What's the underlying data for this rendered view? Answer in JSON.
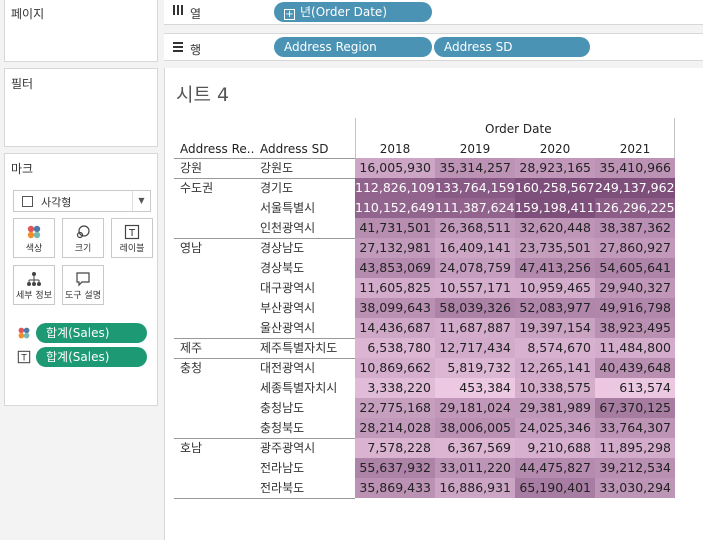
{
  "panels": {
    "pages_title": "페이지",
    "filters_title": "필터",
    "marks_title": "마크"
  },
  "marks": {
    "type_label": "사각형",
    "buttons": [
      {
        "label": "색상",
        "icon": "color-dots-icon"
      },
      {
        "label": "크기",
        "icon": "size-icon"
      },
      {
        "label": "레이블",
        "icon": "label-t-icon"
      },
      {
        "label": "세부 정보",
        "icon": "detail-tree-icon"
      },
      {
        "label": "도구 설명",
        "icon": "tooltip-bubble-icon"
      }
    ],
    "fields": [
      {
        "label": "합계(Sales)",
        "icon": "color-dots-icon"
      },
      {
        "label": "합계(Sales)",
        "icon": "label-t-icon"
      }
    ]
  },
  "shelves": {
    "columns_label": "열",
    "rows_label": "행",
    "columns_pills": [
      "년(Order Date)"
    ],
    "rows_pills": [
      "Address Region",
      "Address SD"
    ]
  },
  "sheet": {
    "title": "시트 4",
    "column_group_header": "Order Date",
    "row_headers": [
      "Address Re..",
      "Address SD"
    ],
    "years": [
      "2018",
      "2019",
      "2020",
      "2021"
    ]
  },
  "colors": {
    "pill_green": "#1d9a73",
    "pill_blue": "#4a93b5",
    "heat_low": "#f2cfe8",
    "heat_high": "#6a3868"
  },
  "chart_data": {
    "type": "heatmap",
    "title": "시트 4",
    "x": [
      "2018",
      "2019",
      "2020",
      "2021"
    ],
    "rows": [
      {
        "region": "강원",
        "sd": "강원도",
        "values": [
          16005930,
          35314257,
          28923165,
          35410966
        ]
      },
      {
        "region": "수도권",
        "sd": "경기도",
        "values": [
          112826109,
          133764159,
          160258567,
          249137962
        ]
      },
      {
        "region": "",
        "sd": "서울특별시",
        "values": [
          110152649,
          111387624,
          159198411,
          126296225
        ]
      },
      {
        "region": "",
        "sd": "인천광역시",
        "values": [
          41731501,
          26368511,
          32620448,
          38387362
        ]
      },
      {
        "region": "영남",
        "sd": "경상남도",
        "values": [
          27132981,
          16409141,
          23735501,
          27860927
        ]
      },
      {
        "region": "",
        "sd": "경상북도",
        "values": [
          43853069,
          24078759,
          47413256,
          54605641
        ]
      },
      {
        "region": "",
        "sd": "대구광역시",
        "values": [
          11605825,
          10557171,
          10959465,
          29940327
        ]
      },
      {
        "region": "",
        "sd": "부산광역시",
        "values": [
          38099643,
          58039326,
          52083977,
          49916798
        ]
      },
      {
        "region": "",
        "sd": "울산광역시",
        "values": [
          14436687,
          11687887,
          19397154,
          38923495
        ]
      },
      {
        "region": "제주",
        "sd": "제주특별자치도",
        "values": [
          6538780,
          12717434,
          8574670,
          11484800
        ]
      },
      {
        "region": "충청",
        "sd": "대전광역시",
        "values": [
          10869662,
          5819732,
          12265141,
          40439648
        ]
      },
      {
        "region": "",
        "sd": "세종특별자치시",
        "values": [
          3338220,
          453384,
          10338575,
          613574
        ]
      },
      {
        "region": "",
        "sd": "충청남도",
        "values": [
          22775168,
          29181024,
          29381989,
          67370125
        ]
      },
      {
        "region": "",
        "sd": "충청북도",
        "values": [
          28214028,
          38006005,
          24025346,
          33764307
        ]
      },
      {
        "region": "호남",
        "sd": "광주광역시",
        "values": [
          7578228,
          6367569,
          9210688,
          11895298
        ]
      },
      {
        "region": "",
        "sd": "전라남도",
        "values": [
          55637932,
          33011220,
          44475827,
          39212534
        ]
      },
      {
        "region": "",
        "sd": "전라북도",
        "values": [
          35869433,
          16886931,
          65190401,
          33030294
        ]
      }
    ]
  }
}
